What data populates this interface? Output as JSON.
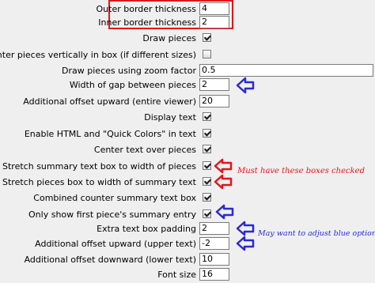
{
  "settings": {
    "outer_border_thickness": {
      "label": "Outer border thickness",
      "value": "4"
    },
    "inner_border_thickness": {
      "label": "Inner border thickness",
      "value": "2"
    },
    "draw_pieces": {
      "label": "Draw pieces",
      "checked": true
    },
    "center_vertically": {
      "label": "Center pieces vertically in box (if different sizes)",
      "checked": false
    },
    "zoom_factor": {
      "label": "Draw pieces using zoom factor",
      "value": "0.5"
    },
    "gap_width": {
      "label": "Width of gap between pieces",
      "value": "2"
    },
    "offset_upward_viewer": {
      "label": "Additional offset upward (entire viewer)",
      "value": "20"
    },
    "display_text": {
      "label": "Display text",
      "checked": true
    },
    "html_quick_colors": {
      "label": "Enable HTML and \"Quick Colors\" in text",
      "checked": true
    },
    "center_text": {
      "label": "Center text over pieces",
      "checked": true
    },
    "stretch_summary_box": {
      "label": "Stretch summary text box to width of pieces",
      "checked": true
    },
    "stretch_pieces_box": {
      "label": "Stretch pieces box to width of summary text",
      "checked": true
    },
    "combined_counter": {
      "label": "Combined counter summary text box",
      "checked": true
    },
    "only_first_summary": {
      "label": "Only show first piece's summary entry",
      "checked": true
    },
    "extra_padding": {
      "label": "Extra text box padding",
      "value": "2"
    },
    "offset_upward_upper": {
      "label": "Additional offset upward (upper text)",
      "value": "-2"
    },
    "offset_downward_lower": {
      "label": "Additional offset downward (lower text)",
      "value": "10"
    },
    "font_size": {
      "label": "Font size",
      "value": "16"
    }
  },
  "annotations": {
    "red_note": "Must have these boxes checked",
    "blue_note": "May want to adjust blue options",
    "red_color": "#e0151d",
    "blue_color": "#2a2ad0"
  }
}
